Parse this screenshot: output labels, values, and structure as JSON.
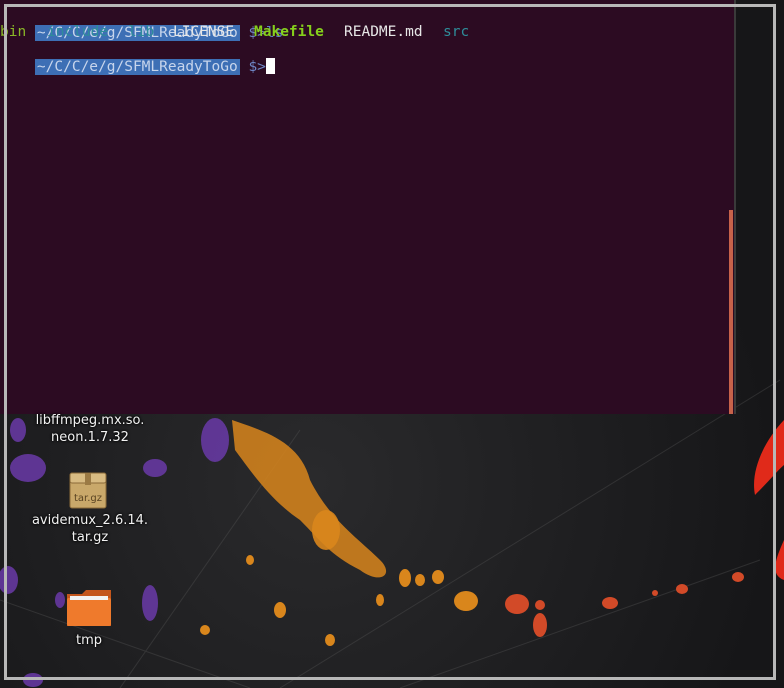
{
  "terminal": {
    "line1": {
      "path": "~/C/C/e/g/SFMLReadyToGo",
      "symbol": " $>",
      "command": "ls"
    },
    "listing": [
      {
        "name": "bin",
        "kind": "bin"
      },
      {
        "name": "include",
        "kind": "dir"
      },
      {
        "name": "lib",
        "kind": "dir"
      },
      {
        "name": "LICENSE",
        "kind": "file"
      },
      {
        "name": "Makefile",
        "kind": "exec"
      },
      {
        "name": "README.md",
        "kind": "file"
      },
      {
        "name": "src",
        "kind": "dir"
      }
    ],
    "line3": {
      "path": "~/C/C/e/g/SFMLReadyToGo",
      "symbol": " $>"
    },
    "colors": {
      "background": "#2c0b22",
      "prompt_bg": "#3d6fb5",
      "dir": "#2e8d9a",
      "exec": "#86d01c",
      "scroll": "#c7624a"
    }
  },
  "desktop": {
    "icons": [
      {
        "name": "libffmpeg-icon",
        "label_line1": "libffmpeg.mx.so.",
        "label_line2": "neon.1.7.32"
      },
      {
        "name": "archive-icon",
        "badge": "tar.gz",
        "label_line1": "avidemux_2.6.14.",
        "label_line2": "tar.gz"
      },
      {
        "name": "folder-icon",
        "label_line1": "tmp"
      }
    ]
  }
}
